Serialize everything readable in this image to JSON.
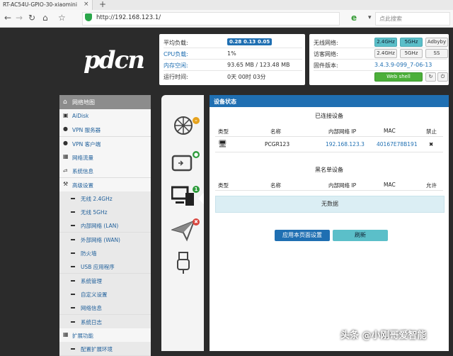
{
  "browser": {
    "tab_title": "RT-AC54U-GPIO-30-xiaomini",
    "tab_close": "×",
    "new_tab": "+",
    "url": "http://192.168.123.1/",
    "search_placeholder": "点此搜索",
    "nav_icons": [
      "back-icon",
      "forward-icon",
      "reload-icon",
      "home-icon",
      "star-icon"
    ]
  },
  "logo": "pdcn",
  "status": {
    "avg_load_label": "平均负载:",
    "avg_load_values": [
      "0.28",
      "0.13",
      "0.05"
    ],
    "cpu_label": "CPU负载:",
    "cpu_value": "1%",
    "mem_label": "内存空闲:",
    "mem_value": "93.65 MB / 123.48 MB",
    "uptime_label": "运行时间:",
    "uptime_value": "0天 00时 03分"
  },
  "system": {
    "wireless_label": "无线网络:",
    "wireless_buttons": [
      "2.4GHz",
      "5GHz",
      "Adbyby"
    ],
    "guest_label": "访客网络:",
    "guest_buttons": [
      "2.4GHz",
      "5GHz",
      "SS"
    ],
    "firmware_label": "固件版本:",
    "firmware_value": "3.4.3.9-099_7-06-13",
    "webshell_label": "Web shell",
    "accent": "#1f6fb2",
    "wifi_on_color": "#5bbfc9"
  },
  "sidebar": {
    "header": "网络地图",
    "items": [
      {
        "label": "AiDisk",
        "icon": "disk-icon",
        "sub": false
      },
      {
        "label": "VPN 服务器",
        "icon": "globe-icon",
        "sub": false
      },
      {
        "label": "VPN 客户端",
        "icon": "globe-icon",
        "sub": false
      },
      {
        "label": "网络流量",
        "icon": "chart-icon",
        "sub": false
      },
      {
        "label": "系统信息",
        "icon": "shuffle-icon",
        "sub": false
      },
      {
        "label": "高级设置",
        "icon": "wrench-icon",
        "sub": false
      },
      {
        "label": "无线 2.4GHz",
        "sub": true
      },
      {
        "label": "无线 5GHz",
        "sub": true
      },
      {
        "label": "内部网络 (LAN)",
        "sub": true
      },
      {
        "label": "外部网络 (WAN)",
        "sub": true
      },
      {
        "label": "防火墙",
        "sub": true
      },
      {
        "label": "USB 应用程序",
        "sub": true
      },
      {
        "label": "系统管理",
        "sub": true
      },
      {
        "label": "自定义设置",
        "sub": true
      },
      {
        "label": "网络信息",
        "sub": true
      },
      {
        "label": "系统日志",
        "sub": true
      },
      {
        "label": "扩展功能",
        "icon": "grid-icon",
        "sub": false
      },
      {
        "label": "配置扩展环境",
        "sub": true
      }
    ]
  },
  "main": {
    "header": "设备状态",
    "connected_title": "已连接设备",
    "columns": [
      "类型",
      "名称",
      "内部网络 IP",
      "MAC",
      "禁止"
    ],
    "devices": [
      {
        "name": "PCGR123",
        "ip": "192.168.123.3",
        "mac": "40167E78B191",
        "block": "✖"
      }
    ],
    "blacklist_title": "黑名单设备",
    "blacklist_columns": [
      "类型",
      "名称",
      "内部网络 IP",
      "MAC",
      "允许"
    ],
    "no_data": "无数据",
    "apply_button": "应用本页面设置",
    "refresh_button": "刷新"
  },
  "watermark": "头条 @小刚哥爱智能"
}
